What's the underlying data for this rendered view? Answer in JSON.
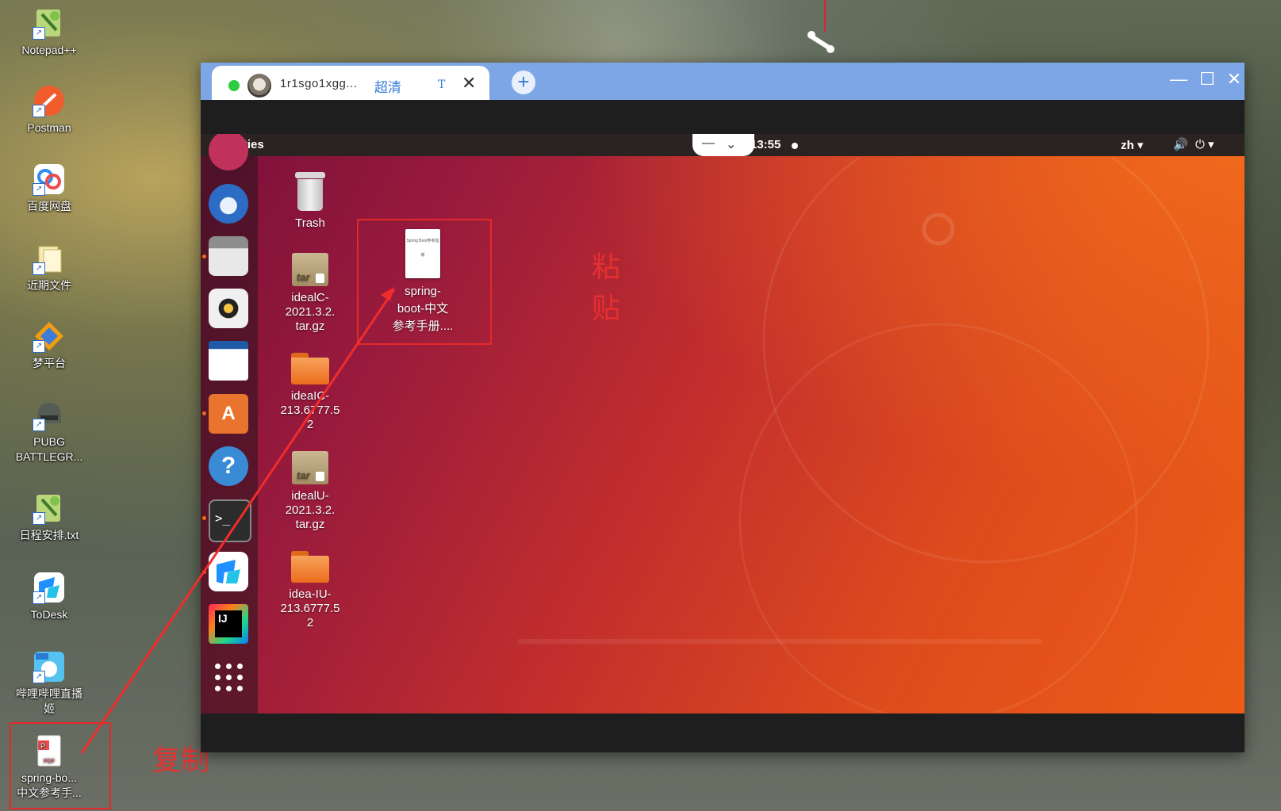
{
  "desktop": {
    "icons": [
      {
        "label": "Notepad++"
      },
      {
        "label": "Postman"
      },
      {
        "label": "百度网盘"
      },
      {
        "label": "近期文件"
      },
      {
        "label": "梦平台"
      },
      {
        "label": "PUBG\nBATTLEGR..."
      },
      {
        "label": "日程安排.txt"
      },
      {
        "label": "ToDesk"
      },
      {
        "label": "哔哩哔哩直播\n姬"
      },
      {
        "label": "spring-bo...\n中文参考手..."
      }
    ],
    "annotation_copy": "复制",
    "annotation_paste": "粘贴"
  },
  "remote_window": {
    "tab": {
      "title": "1r1sgo1xgg...",
      "quality": "超清",
      "flag": "T",
      "close": "✕"
    },
    "new_tab": "+",
    "controls": {
      "minimize": "—",
      "maximize": "☐",
      "close": "✕"
    }
  },
  "ubuntu": {
    "topbar": {
      "activities": "Activities",
      "clock": "13:55",
      "lang": "zh ▾",
      "volume": "🔊",
      "power": "⏻ ▾",
      "minimize": "—",
      "chevron": "⌄"
    },
    "desktop_icons": [
      {
        "label": "Trash"
      },
      {
        "label": "idealC-\n2021.3.2.\ntar.gz"
      },
      {
        "label": "ideaIC-\n213.6777.5\n2"
      },
      {
        "label": "idealU-\n2021.3.2.\ntar.gz"
      },
      {
        "label": "idea-IU-\n213.6777.5\n2"
      },
      {
        "label": "spring-\nboot-中文\n参考手册...."
      }
    ],
    "pdf_thumb_text": "Spring Boot参考指南"
  }
}
